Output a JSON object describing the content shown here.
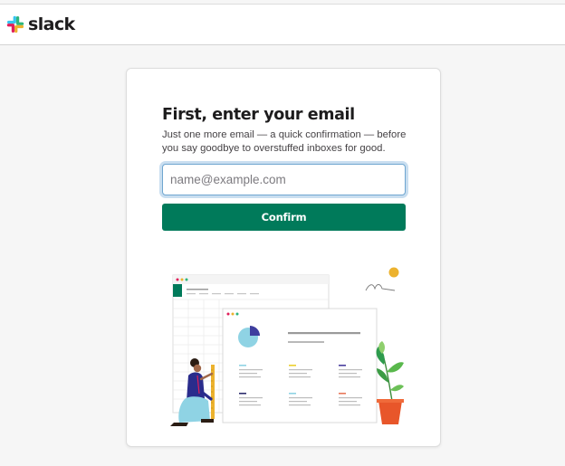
{
  "brand": {
    "name": "slack",
    "colors": {
      "blue": "#36C5F0",
      "green": "#2EB67D",
      "yellow": "#ECB22E",
      "red": "#E01E5A"
    }
  },
  "form": {
    "heading": "First, enter your email",
    "description": "Just one more email — a quick confirmation — before you say goodbye to overstuffed inboxes for good.",
    "email_placeholder": "name@example.com",
    "email_value": "",
    "confirm_label": "Confirm",
    "accent_color": "#007a5a"
  },
  "illustration": {
    "description_icon": "spreadsheet-and-dashboard-illustration"
  }
}
